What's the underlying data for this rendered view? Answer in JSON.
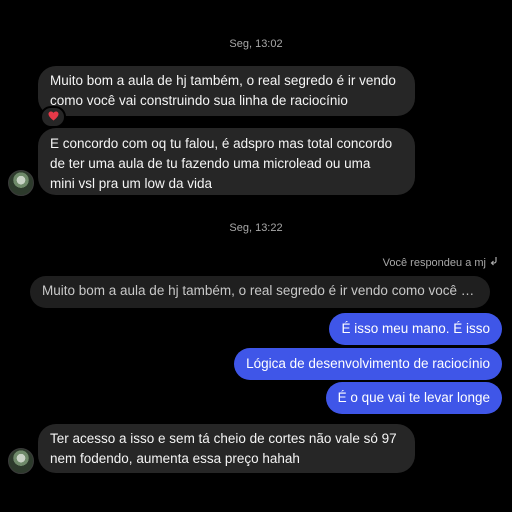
{
  "timestamps": [
    "Seg, 13:02",
    "Seg, 13:22"
  ],
  "messages_in_1": {
    "lines": [
      "Muito bom a aula de hj também, o real segredo é ir vendo",
      "como você vai construindo sua linha de raciocínio"
    ],
    "reaction": "❤️"
  },
  "messages_in_2": {
    "lines": [
      "E concordo com oq tu falou, é adspro mas total concordo",
      "de ter uma aula de tu fazendo uma microlead ou uma",
      "mini vsl pra um low da vida"
    ]
  },
  "reply": {
    "meta": "Você respondeu a mj",
    "quote": "Muito bom a aula de hj também, o real segredo é ir vendo como você vai c..."
  },
  "messages_out": [
    "É isso meu mano. É isso",
    "Lógica de desenvolvimento de raciocínio",
    "É o que vai te levar longe"
  ],
  "messages_in_3": {
    "lines": [
      "Ter acesso a isso e sem tá cheio de cortes não vale só 97",
      "nem fodendo, aumenta essa preço hahah"
    ]
  },
  "colors": {
    "background": "#000000",
    "incoming_bubble": "#262626",
    "outgoing_bubble": "#3f56e8",
    "muted_text": "#a8a8a8"
  },
  "icons": [
    "heart-reaction-icon",
    "reply-arrow-icon",
    "avatar"
  ]
}
